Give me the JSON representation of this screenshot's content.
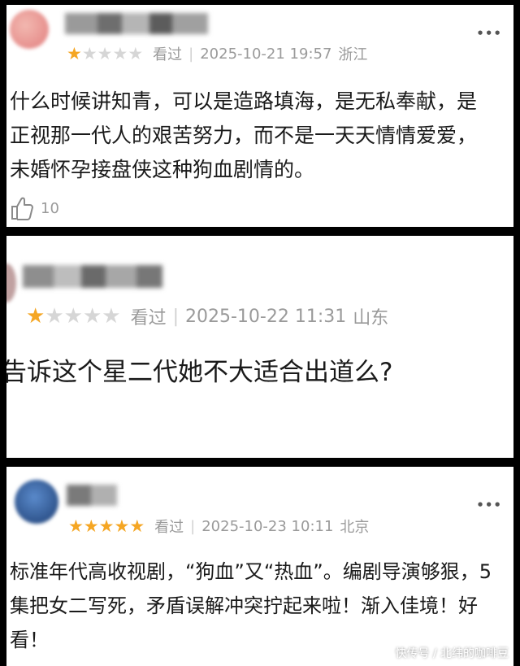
{
  "reviews": [
    {
      "rating": 1,
      "max_rating": 5,
      "status": "看过",
      "date": "2025-10-21 19:57",
      "location": "浙江",
      "content": "什么时候讲知青，可以是造路填海，是无私奉献，是正视那一代人的艰苦努力，而不是一天天情情爱爱，未婚怀孕接盘侠这种狗血剧情的。",
      "likes": "10",
      "more": "•••",
      "avatar_color": "#e89a9a"
    },
    {
      "rating": 1,
      "max_rating": 5,
      "status": "看过",
      "date": "2025-10-22 11:31",
      "location": "山东",
      "content": "告诉这个星二代她不大适合出道么?"
    },
    {
      "rating": 5,
      "max_rating": 5,
      "status": "看过",
      "date": "2025-10-23 10:11",
      "location": "北京",
      "content": "标准年代高收视剧，“狗血”又“热血”。编剧导演够狠，5集把女二写死，矛盾误解冲突拧起来啦！渐入佳境！好看！",
      "more": "•••",
      "avatar_color": "#2f5fa0"
    }
  ],
  "icons": {
    "like": "thumbs-up-icon",
    "star": "star-icon",
    "more": "more-dots-icon"
  },
  "colors": {
    "star_on": "#f5a623",
    "star_off": "#d6d6d6",
    "meta": "#9a9a9a"
  },
  "watermark": "快传号 / 北纬的咖啡豆"
}
